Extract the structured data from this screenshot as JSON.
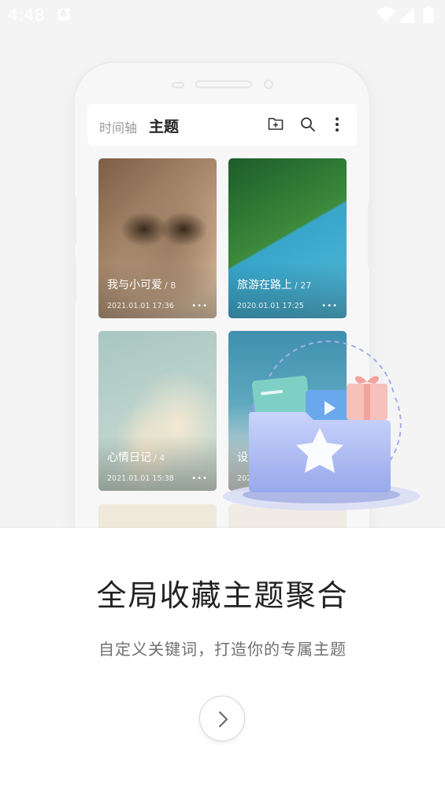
{
  "status_bar": {
    "time": "4:48",
    "icons": [
      "keyboard-a-icon",
      "wifi-icon",
      "signal-icon",
      "battery-icon"
    ]
  },
  "app": {
    "tabs": [
      {
        "label": "时间轴",
        "active": false
      },
      {
        "label": "主题",
        "active": true
      }
    ],
    "header_icons": [
      "add-folder-icon",
      "search-icon",
      "more-vert-icon"
    ],
    "cards": [
      {
        "title": "我与小可爱",
        "count": "/ 8",
        "date": "2021.01.01  17:36"
      },
      {
        "title": "旅游在路上",
        "count": "/ 27",
        "date": "2020.01.01  17:25"
      },
      {
        "title": "心情日记",
        "count": "/ 4",
        "date": "2021.01.01  15:38"
      },
      {
        "title": "设",
        "count": "",
        "date": "2021"
      }
    ]
  },
  "onboarding": {
    "headline": "全局收藏主题聚合",
    "subline": "自定义关键词，打造你的专属主题",
    "next_icon": "chevron-right-icon"
  },
  "colors": {
    "folder_blue": "#a9b9f2",
    "headline": "#222222",
    "subline": "#707070"
  }
}
